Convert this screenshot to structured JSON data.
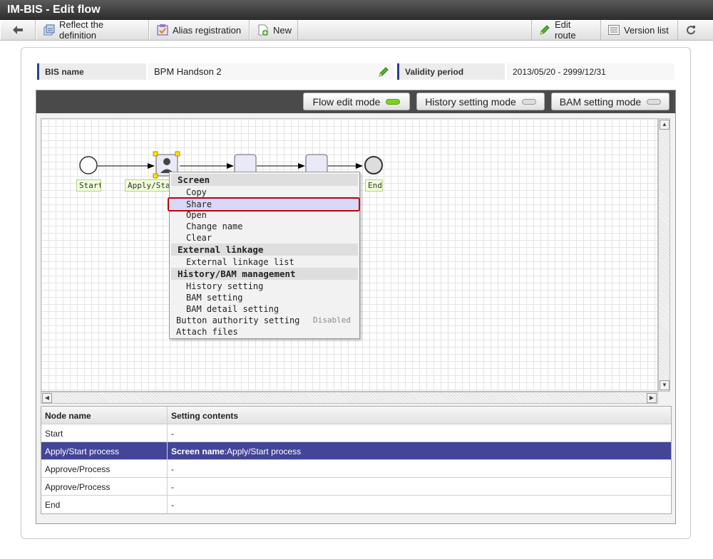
{
  "window": {
    "title": "IM-BIS - Edit flow"
  },
  "toolbar": {
    "reflect_label": "Reflect the definition",
    "alias_label": "Alias registration",
    "new_label": "New",
    "edit_route_label": "Edit route",
    "version_list_label": "Version list"
  },
  "info": {
    "bis_name_label": "BIS name",
    "bis_name_value": "BPM Handson 2",
    "validity_label": "Validity period",
    "validity_value": "2013/05/20 - 2999/12/31"
  },
  "modes": {
    "flow_edit": "Flow edit mode",
    "history_setting": "History setting mode",
    "bam_setting": "BAM setting mode"
  },
  "flow_nodes": {
    "start": "Start",
    "apply": "Apply/Start process",
    "end": "End"
  },
  "context_menu": {
    "screen_header": "Screen",
    "copy": "Copy",
    "share": "Share",
    "open": "Open",
    "change_name": "Change name",
    "clear": "Clear",
    "external_header": "External linkage",
    "external_list": "External linkage list",
    "history_header": "History/BAM management",
    "history_setting": "History setting",
    "bam_setting": "BAM setting",
    "bam_detail": "BAM detail setting",
    "button_authority": "Button authority setting",
    "button_authority_status": "Disabled",
    "attach_files": "Attach files"
  },
  "table": {
    "headers": {
      "node_name": "Node name",
      "setting_contents": "Setting contents"
    },
    "rows": [
      {
        "node": "Start",
        "setting": "-"
      },
      {
        "node": "Apply/Start process",
        "setting_bold": "Screen name",
        "setting": ":Apply/Start process"
      },
      {
        "node": "Approve/Process",
        "setting": "-"
      },
      {
        "node": "Approve/Process",
        "setting": "-"
      },
      {
        "node": "End",
        "setting": "-"
      }
    ]
  }
}
